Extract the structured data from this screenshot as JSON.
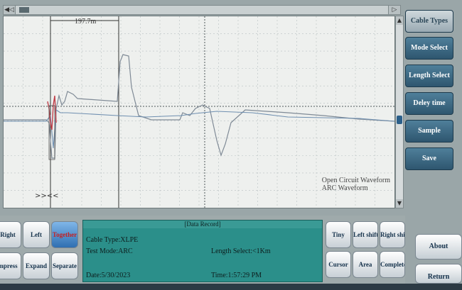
{
  "top_scrollbar": {
    "left_arrow": "◀◁",
    "right_arrow": "▷"
  },
  "plot": {
    "cursor_label": "197.7m",
    "legend": {
      "line1": "Open Circuit Waveform",
      "line2": "ARC Waveform"
    },
    "marker": ">><<"
  },
  "right_panel": {
    "buttons": [
      "Cable Types",
      "Mode Select",
      "Length Select",
      "Deley time",
      "Sample",
      "Save"
    ]
  },
  "left_buttons": [
    "Right",
    "Left",
    "Together",
    "mpress",
    "Expand",
    "Separate"
  ],
  "info": {
    "header": "[Data Record]",
    "cable_type": "Cable Type:XLPE",
    "test_mode": "Test Mode:ARC",
    "length_select": "Length Select:<1Km",
    "date": "Date:5/30/2023",
    "time": "Time:1:57:29 PM"
  },
  "right_buttons": [
    "Tiny",
    "Left shift",
    "Right shift",
    "Cursor",
    "Area",
    "Complete"
  ],
  "side_buttons": {
    "about": "About",
    "return": "Return"
  },
  "colors": {
    "trace_grey": "#7f8a96",
    "trace_blue": "#6f8fb0",
    "trace_red": "#c0404a",
    "accent_teal": "#2b8f8a"
  }
}
